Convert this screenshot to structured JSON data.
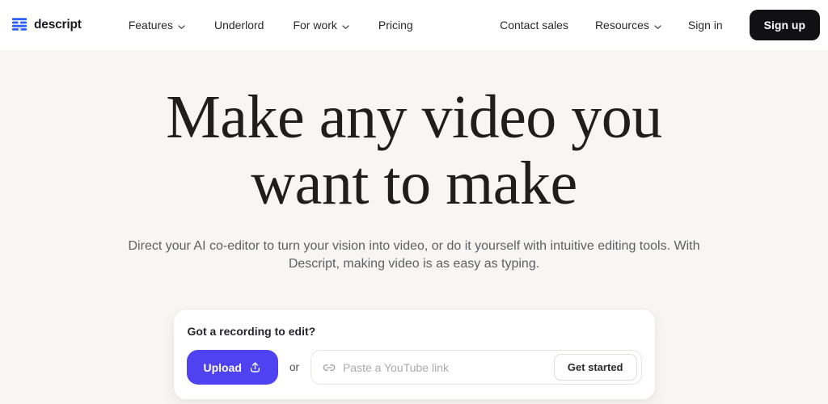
{
  "brand": {
    "name": "descript"
  },
  "nav": {
    "left_items": [
      {
        "label": "Features",
        "has_dropdown": true
      },
      {
        "label": "Underlord",
        "has_dropdown": false
      },
      {
        "label": "For work",
        "has_dropdown": true
      },
      {
        "label": "Pricing",
        "has_dropdown": false
      }
    ],
    "right_items": [
      {
        "label": "Contact sales",
        "has_dropdown": false
      },
      {
        "label": "Resources",
        "has_dropdown": true
      },
      {
        "label": "Sign in",
        "has_dropdown": false
      }
    ],
    "signup_label": "Sign up"
  },
  "hero": {
    "title_line1": "Make any video you",
    "title_line2": "want to make",
    "subtitle_line1": "Direct your AI co-editor to turn your vision into video, or do it yourself with intuitive editing tools. With",
    "subtitle_line2": "Descript, making video is as easy as typing."
  },
  "cta_card": {
    "prompt": "Got a recording to edit?",
    "upload_label": "Upload",
    "or_label": "or",
    "youtube_placeholder": "Paste a YouTube link",
    "get_started_label": "Get started"
  },
  "icons": {
    "logo": "descript-stripes-logo",
    "nav_dropdown": "chevron-down-icon",
    "upload": "upload-arrow-icon",
    "youtube_field": "link-chain-icon"
  },
  "colors": {
    "accent_purple": "#4f42f0",
    "brand_blue": "#2e62f4",
    "signup_bg": "#111113",
    "header_bg": "#ffffff",
    "page_bg": "#f8f6f3",
    "heading_text": "#201d1c",
    "subtitle_text": "#5d5f64"
  }
}
